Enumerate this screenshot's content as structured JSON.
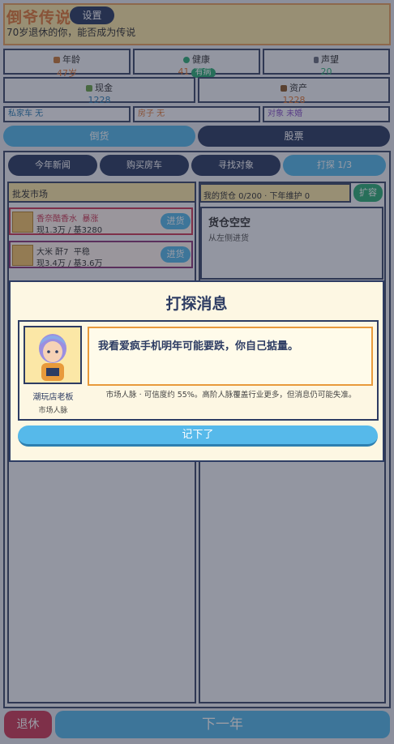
{
  "header": {
    "title": "倒爷传说",
    "settings_label": "设置",
    "subtitle": "70岁退休的你，能否成为传说"
  },
  "stats": {
    "age": {
      "label": "年龄",
      "value": "47岁",
      "icon": "lock-icon"
    },
    "health": {
      "label": "健康",
      "value": "41",
      "badge": "有病",
      "icon": "heart-icon"
    },
    "reputation": {
      "label": "声望",
      "value": "20",
      "icon": "trophy-icon"
    },
    "cash": {
      "label": "现金",
      "value": "1228",
      "icon": "money-icon"
    },
    "assets": {
      "label": "资产",
      "value": "1228",
      "icon": "bag-icon"
    }
  },
  "info": {
    "car": "私家车 无",
    "house": "房子 无",
    "partner": "对象 未婚"
  },
  "main_tabs": {
    "goods": "倒货",
    "stocks": "股票"
  },
  "sub_tabs": {
    "news": "今年新闻",
    "buy_house": "购买房车",
    "find_partner": "寻找对象",
    "scout": "打探 1/3"
  },
  "market": {
    "title": "批发市场",
    "items": [
      {
        "name": "香奈酷香水",
        "trend": "暴涨",
        "price": "现1.3万 / 基3280",
        "button": "进货"
      },
      {
        "name": "大米 酐7",
        "trend": "平稳",
        "price": "现3.4万 / 基3.6万",
        "button": "进货"
      }
    ]
  },
  "warehouse": {
    "header": "我的货仓 0/200 · 下年维护 0",
    "expand_label": "扩容",
    "empty_title": "货仓空空",
    "empty_sub": "从左侧进货"
  },
  "modal": {
    "title": "打探消息",
    "speaker_name": "潮玩店老板",
    "speaker_role": "市场人脉",
    "message": "我看爱疯手机明年可能要跌，你自己掂量。",
    "note": "市场人脉 · 可信度约 55%。高阶人脉覆盖行业更多，但消息仍可能失准。",
    "confirm_label": "记下了"
  },
  "bottom": {
    "retire_label": "退休",
    "next_year_label": "下一年"
  },
  "colors": {
    "accent_orange": "#e07a3a",
    "navy": "#2d3c63",
    "sky": "#56b9ea",
    "green": "#2fae77",
    "red": "#cc3b58"
  }
}
